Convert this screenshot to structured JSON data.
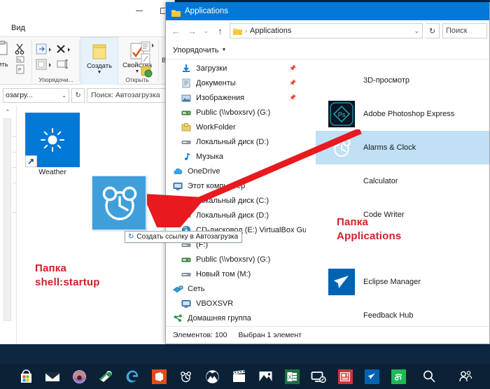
{
  "left_window": {
    "tab_label": "Вид",
    "ribbon": {
      "groups": [
        {
          "label": "Упорядочи...",
          "buttons": []
        },
        {
          "label": "",
          "buttons": [
            {
              "label": "Создать",
              "icon": "new-folder-icon"
            }
          ]
        },
        {
          "label": "Открыть",
          "buttons": [
            {
              "label": "Свойства",
              "icon": "properties-icon"
            }
          ]
        },
        {
          "label": "",
          "buttons": [
            {
              "label": "В",
              "icon": "select-icon"
            }
          ]
        }
      ],
      "paste_label": "вить",
      "cut_icon": "scissors-icon",
      "move_icon": "move-to-icon",
      "delete_icon": "delete-x-icon",
      "rename_icon": "rename-icon"
    },
    "address": {
      "path_value": "озагру...",
      "dropdown_icon": "chevron-down-icon",
      "refresh_icon": "refresh-icon",
      "search_placeholder": "Поиск: Автозагрузка"
    },
    "desktop_items": [
      {
        "name": "Weather",
        "icon": "weather-sun-icon",
        "shortcut": true
      },
      {
        "name": "",
        "icon": "alarm-clock-icon",
        "shortcut": false,
        "dragging": true
      }
    ],
    "drag_tooltip": {
      "icon": "create-link-icon",
      "text": "Создать ссылку в Автозагрузка"
    },
    "annotation": {
      "line1": "Папка",
      "line2": "shell:startup",
      "color": "#cc2229"
    }
  },
  "right_window": {
    "title": "Applications",
    "title_icon": "folder-icon",
    "nav": {
      "back_icon": "arrow-left-icon",
      "forward_icon": "arrow-right-icon",
      "history_icon": "chevron-down-icon",
      "up_icon": "arrow-up-icon",
      "breadcrumb_icon": "folder-icon",
      "breadcrumb_sep": "›",
      "breadcrumb_text": "Applications",
      "dropdown_icon": "chevron-down-icon",
      "refresh_icon": "refresh-icon",
      "search_placeholder": "Поиск"
    },
    "toolbar": {
      "organize_label": "Упорядочить",
      "caret_icon": "chevron-down-icon"
    },
    "nav_pane": [
      {
        "label": "Загрузки",
        "icon": "downloads-icon",
        "pinned": true,
        "indent": true
      },
      {
        "label": "Документы",
        "icon": "documents-icon",
        "pinned": true,
        "indent": true
      },
      {
        "label": "Изображения",
        "icon": "pictures-icon",
        "pinned": true,
        "indent": true
      },
      {
        "label": "Public (\\\\vboxsrv) (G:)",
        "icon": "network-drive-icon",
        "pinned": false,
        "indent": true
      },
      {
        "label": "WorkFolder",
        "icon": "folder-yellow-icon",
        "pinned": false,
        "indent": true
      },
      {
        "label": "Локальный диск (D:)",
        "icon": "drive-icon",
        "pinned": false,
        "indent": true
      },
      {
        "label": "Музыка",
        "icon": "music-icon",
        "pinned": false,
        "indent": true
      },
      {
        "label": "OneDrive",
        "icon": "onedrive-icon",
        "pinned": false,
        "indent": false
      },
      {
        "label": "Этот компьютер",
        "icon": "this-pc-icon",
        "pinned": false,
        "indent": false
      },
      {
        "label": "Локальный диск (C:)",
        "icon": "drive-icon",
        "pinned": false,
        "indent": true
      },
      {
        "label": "Локальный диск (D:)",
        "icon": "drive-icon",
        "pinned": false,
        "indent": true
      },
      {
        "label": "CD-дисковод (E:) VirtualBox Gue",
        "icon": "cd-drive-icon",
        "pinned": false,
        "indent": true
      },
      {
        "label": "(F:)",
        "icon": "drive-icon",
        "pinned": false,
        "indent": true
      },
      {
        "label": "Public (\\\\vboxsrv) (G:)",
        "icon": "network-drive-icon",
        "pinned": false,
        "indent": true
      },
      {
        "label": "Новый том (M:)",
        "icon": "drive-icon",
        "pinned": false,
        "indent": true
      },
      {
        "label": "Сеть",
        "icon": "network-icon",
        "pinned": false,
        "indent": false
      },
      {
        "label": "VBOXSVR",
        "icon": "this-pc-icon",
        "pinned": false,
        "indent": true
      },
      {
        "label": "Домашняя группа",
        "icon": "homegroup-icon",
        "pinned": false,
        "indent": false
      }
    ],
    "scroll": {
      "up_icon": "chevron-up-icon",
      "down_icon": "chevron-down-icon"
    },
    "apps": [
      {
        "name": "3D-просмотр",
        "icon": "none",
        "selected": false,
        "has_tile": false
      },
      {
        "name": "Adobe Photoshop Express",
        "icon": "photoshop-express-icon",
        "selected": false,
        "has_tile": true,
        "tile_color": "#0a1520"
      },
      {
        "name": "Alarms & Clock",
        "icon": "alarm-clock-icon",
        "selected": true,
        "has_tile": false
      },
      {
        "name": "Calculator",
        "icon": "none",
        "selected": false,
        "has_tile": false
      },
      {
        "name": "Code Writer",
        "icon": "none",
        "selected": false,
        "has_tile": false
      },
      {
        "name": "Eclipse Manager",
        "icon": "eclipse-manager-icon",
        "selected": false,
        "has_tile": true,
        "tile_color": "#0063b1"
      },
      {
        "name": "Feedback Hub",
        "icon": "none",
        "selected": false,
        "has_tile": false
      }
    ],
    "status": {
      "items_count": "Элементов: 100",
      "selection": "Выбран 1 элемент"
    },
    "annotation": {
      "line1": "Папка",
      "line2": "Applications",
      "color": "#cc2229"
    }
  },
  "taskbar": {
    "icons": [
      {
        "name": "microsoft-store-icon",
        "color": "#ffffff"
      },
      {
        "name": "mail-icon",
        "color": "#ffffff"
      },
      {
        "name": "groove-music-icon",
        "color": "#8e5ea8"
      },
      {
        "name": "paint-3d-icon",
        "color": "#4aa84a"
      },
      {
        "name": "edge-icon",
        "color": "#3ba7dd"
      },
      {
        "name": "office-icon",
        "color": "#e64a19"
      },
      {
        "name": "alarms-clock-icon",
        "color": "#ffffff"
      },
      {
        "name": "xbox-icon",
        "color": "#ffffff"
      },
      {
        "name": "movies-tv-icon",
        "color": "#ffffff"
      },
      {
        "name": "photos-icon",
        "color": "#ffffff"
      },
      {
        "name": "excel-icon",
        "color": "#1d7044"
      },
      {
        "name": "connect-icon",
        "color": "#ffffff"
      },
      {
        "name": "news-icon",
        "color": "#d13438"
      },
      {
        "name": "eclipse-manager-icon",
        "color": "#0063b1"
      },
      {
        "name": "spotify-icon",
        "color": "#1db954"
      },
      {
        "name": "search-icon",
        "color": "#ffffff"
      },
      {
        "name": "people-icon",
        "color": "#ffffff"
      }
    ]
  },
  "window_controls": {
    "minimize_icon": "minimize-icon",
    "maximize_icon": "maximize-icon"
  }
}
